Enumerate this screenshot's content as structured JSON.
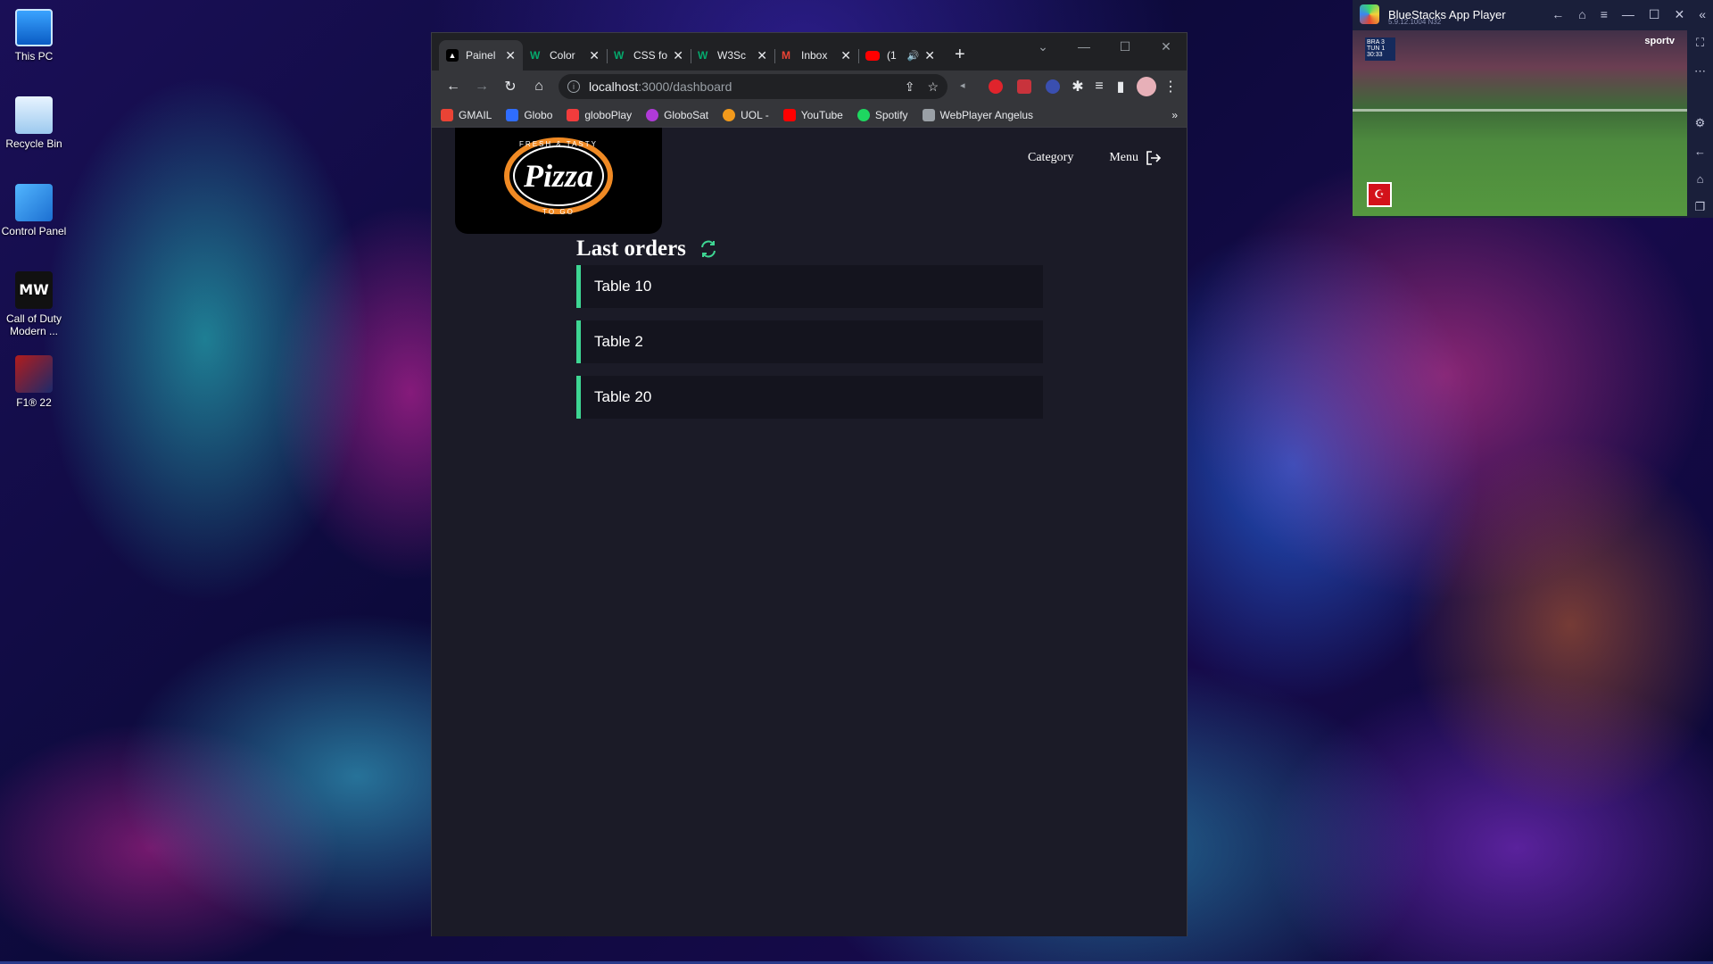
{
  "desktop": {
    "icons": [
      {
        "label": "This PC"
      },
      {
        "label": "Recycle Bin"
      },
      {
        "label": "Control Panel"
      },
      {
        "label": "Call of Duty Modern ..."
      },
      {
        "label": "F1® 22"
      }
    ],
    "mw_glyph": "MW"
  },
  "browser": {
    "tabs": [
      {
        "title": "Painel",
        "favicon": "app-icon",
        "color": "#ffffff"
      },
      {
        "title": "Color",
        "favicon": "w3schools-icon",
        "color": "#04aa6d"
      },
      {
        "title": "CSS fo",
        "favicon": "w3schools-icon",
        "color": "#04aa6d"
      },
      {
        "title": "W3Sc",
        "favicon": "w3schools-icon",
        "color": "#04aa6d"
      },
      {
        "title": "Inbox",
        "favicon": "gmail-icon",
        "color": "#ea4335"
      },
      {
        "title": "(1",
        "favicon": "youtube-icon",
        "color": "#ff0000"
      }
    ],
    "new_tab_glyph": "+",
    "url": {
      "host": "localhost",
      "path": ":3000/dashboard"
    },
    "bookmarks": [
      {
        "label": "GMAIL",
        "color": "#ea4335"
      },
      {
        "label": "Globo",
        "color": "#2f6dff"
      },
      {
        "label": "globoPlay",
        "color": "#f23c3c"
      },
      {
        "label": "GloboSat",
        "color": "#b03ad8"
      },
      {
        "label": "UOL -",
        "color": "#f29a1c"
      },
      {
        "label": "YouTube",
        "color": "#ff0000"
      },
      {
        "label": "Spotify",
        "color": "#1ed760"
      },
      {
        "label": "WebPlayer Angelus",
        "color": "#9aa0a6"
      }
    ],
    "bookmarks_more": "»"
  },
  "app": {
    "logo": {
      "top_text": "FRESH & TASTY",
      "main_text": "Pizza",
      "bottom_text": "TO GO"
    },
    "nav": {
      "category": "Category",
      "menu": "Menu"
    },
    "heading": "Last orders",
    "accent": "#3ed693",
    "orders": [
      {
        "label": "Table 10"
      },
      {
        "label": "Table 2"
      },
      {
        "label": "Table 20"
      }
    ]
  },
  "bluestacks": {
    "title": "BlueStacks App Player",
    "version": "5.9.12.1004 N32",
    "channel": "sportv",
    "score": {
      "home": "BRA",
      "away": "TUN",
      "home_goals": "3",
      "away_goals": "1",
      "clock": "30:33"
    }
  }
}
